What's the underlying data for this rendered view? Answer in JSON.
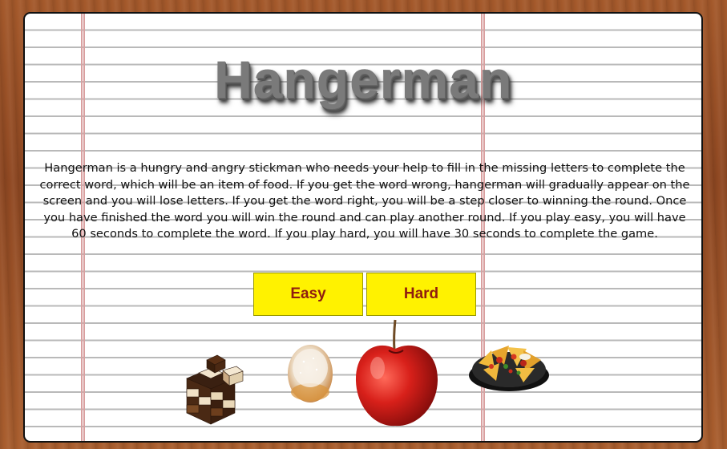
{
  "game": {
    "title": "Hangerman",
    "description": "Hangerman is a hungry and angry stickman who needs your help to fill in the missing letters to complete the correct word, which will be an item of food. If you get the word wrong, hangerman will gradually appear on the screen and you will lose letters. If you get the word right, you will be a step closer to winning the round. Once you have finished the word you will win the round and can play another round. If you play easy, you will have 60 seconds to complete the word. If you play hard, you will have 30 seconds to complete the game.",
    "buttons": {
      "easy_label": "Easy",
      "hard_label": "Hard"
    },
    "food_images": [
      "chocolate-image",
      "donut-image",
      "apple-image",
      "nachos-image"
    ]
  },
  "colors": {
    "button_bg": "#fff200",
    "button_text": "#8f1d10",
    "paper": "#ffffff",
    "table_wood": "#9c5327"
  }
}
